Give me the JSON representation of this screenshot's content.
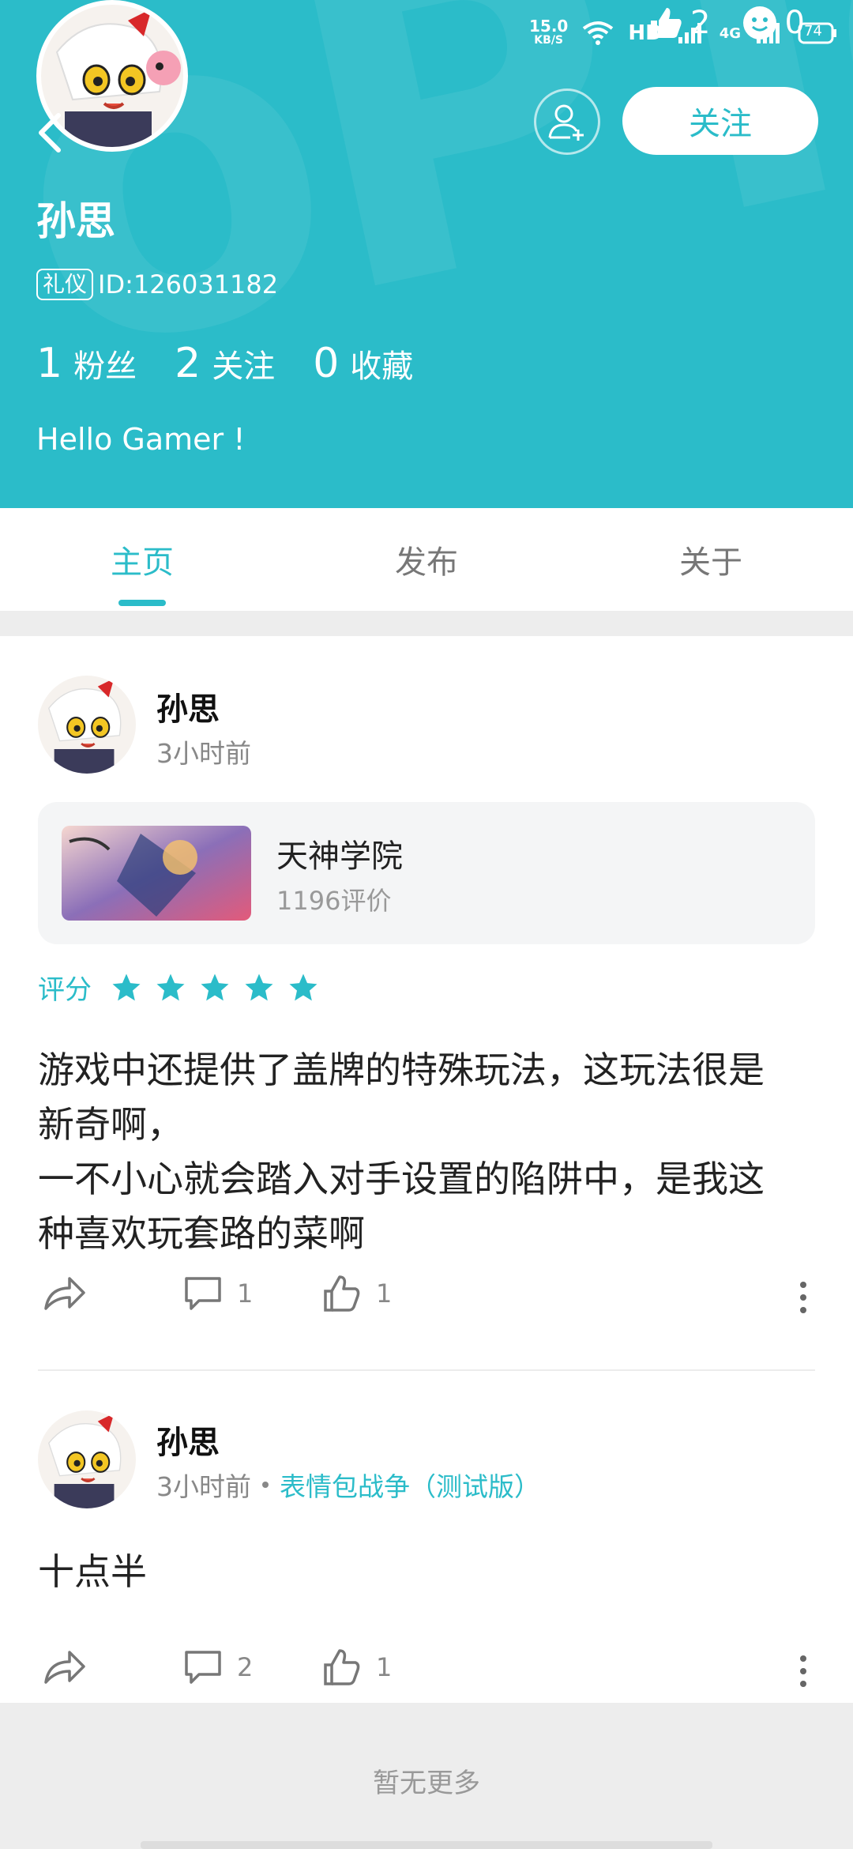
{
  "colors": {
    "brand": "#2bbcc9",
    "text": "#222222",
    "muted": "#888888",
    "background": "#ffffff"
  },
  "status_bar": {
    "speed_value": "15.0",
    "speed_unit": "KB/S",
    "hd": "HD",
    "network": "4G",
    "battery": "74"
  },
  "floating_counts": {
    "likes": "2",
    "emoji": "0"
  },
  "profile": {
    "name": "孙思",
    "tag": "礼仪",
    "id_text": "ID:126031182",
    "stats": [
      {
        "num": "1",
        "label": "粉丝"
      },
      {
        "num": "2",
        "label": "关注"
      },
      {
        "num": "0",
        "label": "收藏"
      }
    ],
    "bio": "Hello Gamer !",
    "follow_label": "关注"
  },
  "tabs": [
    {
      "label": "主页",
      "active": true
    },
    {
      "label": "发布",
      "active": false
    },
    {
      "label": "关于",
      "active": false
    }
  ],
  "posts": [
    {
      "user": "孙思",
      "time": "3小时前",
      "game": {
        "name": "天神学院",
        "reviews": "1196评价"
      },
      "rating_label": "评分",
      "rating": 5,
      "text": "游戏中还提供了盖牌的特殊玩法，这玩法很是\n新奇啊，\n一不小心就会踏入对手设置的陷阱中，是我这\n种喜欢玩套路的菜啊",
      "comments": "1",
      "likes": "1"
    },
    {
      "user": "孙思",
      "time": "3小时前",
      "topic": "表情包战争（测试版）",
      "text": "十点半",
      "comments": "2",
      "likes": "1"
    }
  ],
  "footer": {
    "text": "暂无更多"
  },
  "icons": {
    "back": "back-arrow-icon",
    "add_friend": "add-user-icon",
    "star": "star-icon",
    "share": "share-icon",
    "comment": "comment-icon",
    "like": "thumbs-up-icon",
    "more": "more-vertical-icon"
  }
}
